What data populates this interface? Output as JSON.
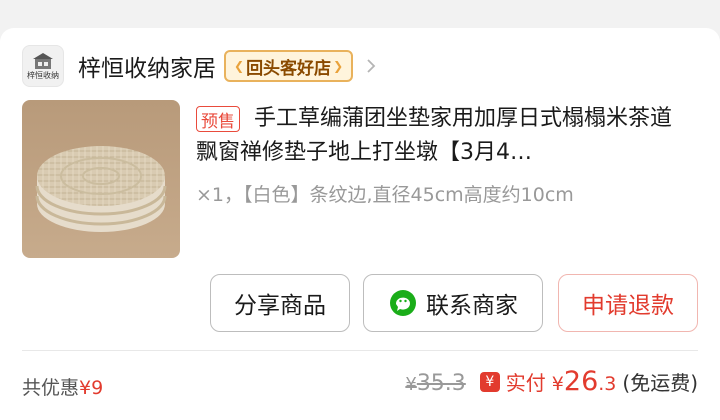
{
  "shop": {
    "name": "梓恒收纳家居",
    "logo_text": "梓恒收纳",
    "badge": "回头客好店"
  },
  "product": {
    "presale_tag": "预售",
    "title": "手工草编蒲团坐垫家用加厚日式榻榻米茶道飘窗禅修垫子地上打坐墩【3月4…",
    "spec": "×1，【白色】条纹边,直径45cm高度约10cm"
  },
  "actions": {
    "share": "分享商品",
    "contact": "联系商家",
    "refund": "申请退款"
  },
  "footer": {
    "discount_label": "共优惠",
    "discount_amount": "¥9",
    "original_currency": "¥",
    "original_price": "35.3",
    "paid_icon": "¥",
    "paid_label": "实付",
    "paid_currency": "¥",
    "paid_int": "26",
    "paid_dec": ".3",
    "shipping": "(免运费)"
  },
  "colors": {
    "accent_red": "#e23b2e",
    "badge_gold": "#e9b25c",
    "wechat_green": "#1aad19"
  },
  "icons": [
    "shop-logo-icon",
    "chevron-right-icon",
    "wechat-icon",
    "yen-icon"
  ]
}
